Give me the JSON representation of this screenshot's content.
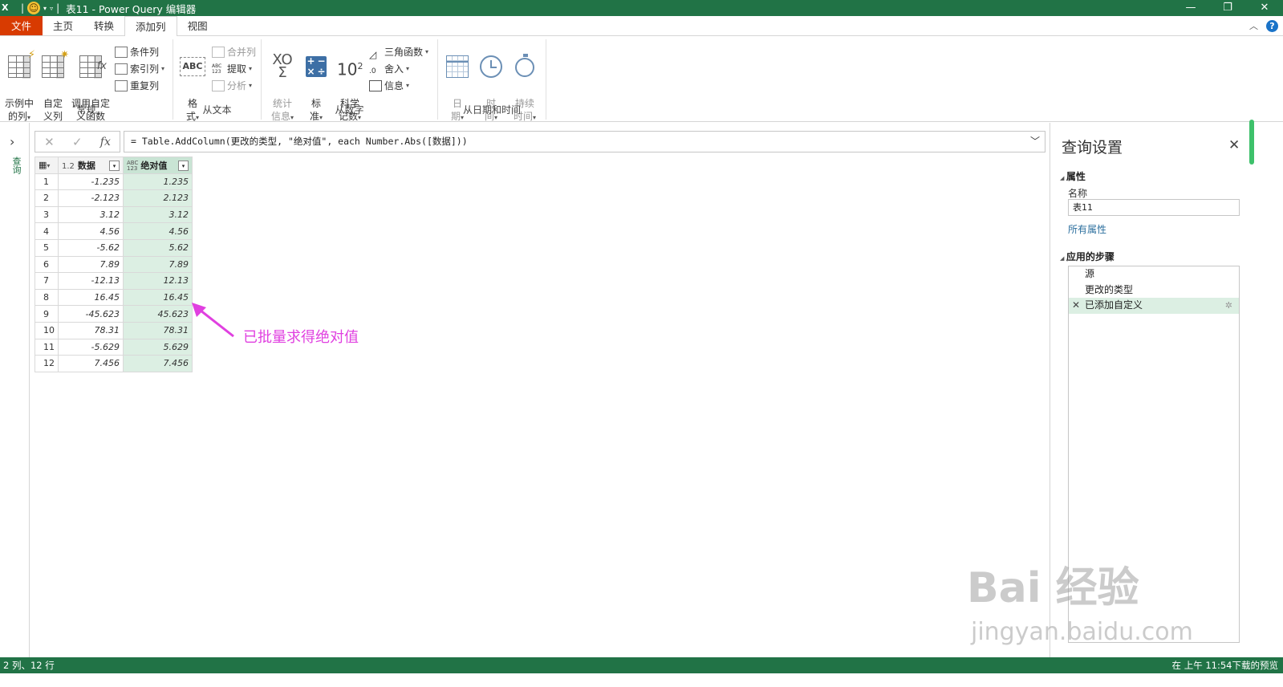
{
  "titlebar": {
    "app_icon": "X",
    "title": "表11 - Power Query 编辑器",
    "qa_separator": "|"
  },
  "menu": {
    "tabs": [
      "文件",
      "主页",
      "转换",
      "添加列",
      "视图"
    ],
    "active_index": 3
  },
  "ribbon": {
    "groups": {
      "general": {
        "label": "常规",
        "example_col": "示例中\n的列",
        "custom_col": "自定\n义列",
        "invoke_fn": "调用自定\n义函数",
        "conditional": "条件列",
        "index": "索引列",
        "duplicate": "重复列"
      },
      "text": {
        "label": "从文本",
        "format": "格\n式",
        "merge": "合并列",
        "extract": "提取",
        "parse": "分析",
        "abc123": "ABC\n123"
      },
      "number": {
        "label": "从数字",
        "stats": "统计\n信息",
        "standard": "标\n准",
        "scientific": "科学\n记数",
        "trig": "三角函数",
        "round": "舍入",
        "info": "信息",
        "sci_base": "10",
        "sci_exp": "2",
        "sigma_symbol": "XO\nΣ"
      },
      "datetime": {
        "label": "从日期和时间",
        "date": "日\n期",
        "time": "时\n间",
        "duration": "持续\n时间"
      }
    }
  },
  "formula": {
    "cancel": "✕",
    "confirm": "✓",
    "fx": "fx",
    "text": "= Table.AddColumn(更改的类型, \"绝对值\", each Number.Abs([数据]))"
  },
  "leftpane": {
    "label": "查询"
  },
  "table": {
    "columns": [
      {
        "type": "1.2",
        "name": "数据"
      },
      {
        "type": "ABC\n123",
        "name": "绝对值"
      }
    ],
    "rows": [
      [
        "1",
        "-1.235",
        "1.235"
      ],
      [
        "2",
        "-2.123",
        "2.123"
      ],
      [
        "3",
        "3.12",
        "3.12"
      ],
      [
        "4",
        "4.56",
        "4.56"
      ],
      [
        "5",
        "-5.62",
        "5.62"
      ],
      [
        "6",
        "7.89",
        "7.89"
      ],
      [
        "7",
        "-12.13",
        "12.13"
      ],
      [
        "8",
        "16.45",
        "16.45"
      ],
      [
        "9",
        "-45.623",
        "45.623"
      ],
      [
        "10",
        "78.31",
        "78.31"
      ],
      [
        "11",
        "-5.629",
        "5.629"
      ],
      [
        "12",
        "7.456",
        "7.456"
      ]
    ]
  },
  "annotation": "已批量求得绝对值",
  "settings": {
    "title": "查询设置",
    "properties": "属性",
    "name_label": "名称",
    "name_value": "表11",
    "all_props": "所有属性",
    "steps_label": "应用的步骤",
    "steps": [
      "源",
      "更改的类型",
      "已添加自定义"
    ]
  },
  "status": {
    "left": "2 列、12 行",
    "right": "在 上午 11:54下载的预览"
  },
  "watermark": {
    "brand": "Bai 经验",
    "url": "jingyan.baidu.com"
  },
  "colors": {
    "accent": "#217346",
    "file_tab": "#d83b01",
    "annotation": "#e040e0",
    "selected_col": "#dcefe3"
  }
}
